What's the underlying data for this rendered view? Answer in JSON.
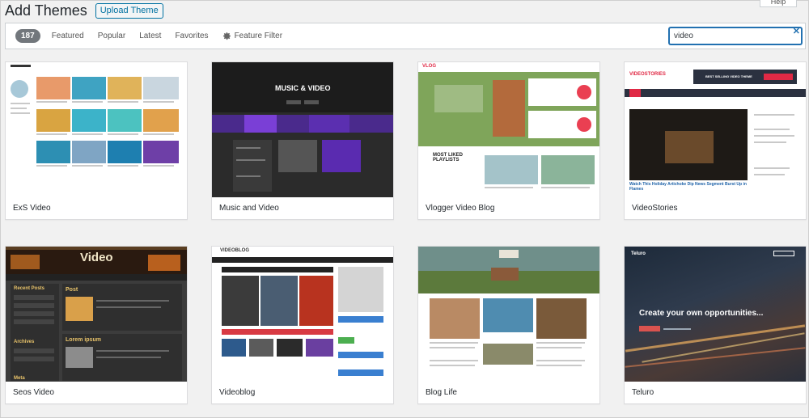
{
  "header": {
    "title": "Add Themes",
    "upload_label": "Upload Theme",
    "help_label": "Help"
  },
  "filters": {
    "count": "187",
    "links": [
      "Featured",
      "Popular",
      "Latest",
      "Favorites"
    ],
    "feature_filter": "Feature Filter",
    "search_value": "video"
  },
  "themes": [
    {
      "name": "ExS Video"
    },
    {
      "name": "Music and Video",
      "banner": "MUSIC & VIDEO"
    },
    {
      "name": "Vlogger Video Blog",
      "banner": "VLOG",
      "caption": "MOST LIKED PLAYLISTS"
    },
    {
      "name": "VideoStories",
      "banner": "VIDEOSTORIES",
      "caption": "BEST SELLING VIDEO THEME",
      "headline": "Watch This Holiday Artichoke Dip News Segment Burst Up in Flames"
    },
    {
      "name": "Seos Video",
      "banner": "Video",
      "post": "Post",
      "posts_heading": "Recent Posts",
      "archives": "Archives",
      "meta": "Meta",
      "lorem": "Lorem ipsum"
    },
    {
      "name": "Videoblog",
      "banner": "VIDEOBLOG"
    },
    {
      "name": "Blog Life"
    },
    {
      "name": "Teluro",
      "banner": "Teluro",
      "caption": "Create your own opportunities..."
    }
  ]
}
